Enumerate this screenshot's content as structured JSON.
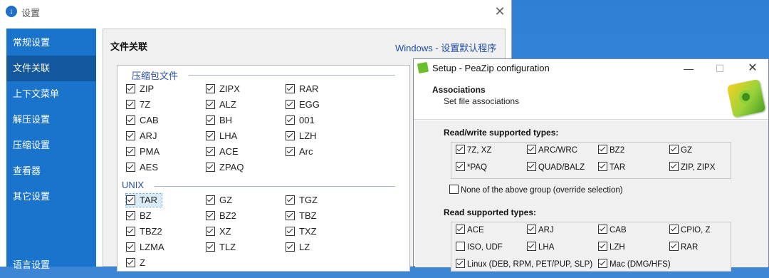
{
  "settings_window": {
    "title": "设置",
    "sidebar": [
      {
        "label": "常规设置",
        "active": false
      },
      {
        "label": "文件关联",
        "active": true
      },
      {
        "label": "上下文菜单",
        "active": false
      },
      {
        "label": "解压设置",
        "active": false
      },
      {
        "label": "压缩设置",
        "active": false
      },
      {
        "label": "查看器",
        "active": false
      },
      {
        "label": "其它设置",
        "active": false
      },
      {
        "label": "语言设置",
        "active": false
      }
    ],
    "panel_title": "文件关联",
    "panel_link": "Windows - 设置默认程序",
    "groups": [
      {
        "name": "压缩包文件",
        "items": [
          {
            "label": "ZIP",
            "checked": true
          },
          {
            "label": "ZIPX",
            "checked": true
          },
          {
            "label": "RAR",
            "checked": true
          },
          {
            "label": "7Z",
            "checked": true
          },
          {
            "label": "ALZ",
            "checked": true
          },
          {
            "label": "EGG",
            "checked": true
          },
          {
            "label": "CAB",
            "checked": true
          },
          {
            "label": "BH",
            "checked": true
          },
          {
            "label": "001",
            "checked": true
          },
          {
            "label": "ARJ",
            "checked": true
          },
          {
            "label": "LHA",
            "checked": true
          },
          {
            "label": "LZH",
            "checked": true
          },
          {
            "label": "PMA",
            "checked": true
          },
          {
            "label": "ACE",
            "checked": true
          },
          {
            "label": "Arc",
            "checked": true
          },
          {
            "label": "AES",
            "checked": true
          },
          {
            "label": "ZPAQ",
            "checked": true
          }
        ]
      },
      {
        "name": "UNIX",
        "items": [
          {
            "label": "TAR",
            "checked": true
          },
          {
            "label": "GZ",
            "checked": true
          },
          {
            "label": "TGZ",
            "checked": true
          },
          {
            "label": "BZ",
            "checked": true
          },
          {
            "label": "BZ2",
            "checked": true
          },
          {
            "label": "TBZ",
            "checked": true
          },
          {
            "label": "TBZ2",
            "checked": true
          },
          {
            "label": "XZ",
            "checked": true
          },
          {
            "label": "TXZ",
            "checked": true
          },
          {
            "label": "LZMA",
            "checked": true
          },
          {
            "label": "TLZ",
            "checked": true
          },
          {
            "label": "LZ",
            "checked": true
          },
          {
            "label": "Z",
            "checked": true
          }
        ]
      }
    ]
  },
  "peazip_window": {
    "title": "Setup - PeaZip configuration",
    "header_title": "Associations",
    "header_subtitle": "Set file associations",
    "rw_title": "Read/write supported types:",
    "rw_items": [
      {
        "label": "7Z, XZ",
        "checked": true
      },
      {
        "label": "ARC/WRC",
        "checked": true
      },
      {
        "label": "BZ2",
        "checked": true
      },
      {
        "label": "GZ",
        "checked": true
      },
      {
        "label": "*PAQ",
        "checked": true
      },
      {
        "label": "QUAD/BALZ",
        "checked": true
      },
      {
        "label": "TAR",
        "checked": true
      },
      {
        "label": "ZIP, ZIPX",
        "checked": true
      }
    ],
    "none_label": "None of the above group (override selection)",
    "none_checked": false,
    "r_title": "Read supported types:",
    "r_items": [
      {
        "label": "ACE",
        "checked": true
      },
      {
        "label": "ARJ",
        "checked": true
      },
      {
        "label": "CAB",
        "checked": true
      },
      {
        "label": "CPIO, Z",
        "checked": true
      },
      {
        "label": "ISO, UDF",
        "checked": false
      },
      {
        "label": "LHA",
        "checked": true
      },
      {
        "label": "LZH",
        "checked": true
      },
      {
        "label": "RAR",
        "checked": true
      },
      {
        "label": "Linux (DEB, RPM, PET/PUP, SLP)",
        "checked": true
      },
      {
        "label": "Mac (DMG/HFS)",
        "checked": true
      }
    ]
  }
}
